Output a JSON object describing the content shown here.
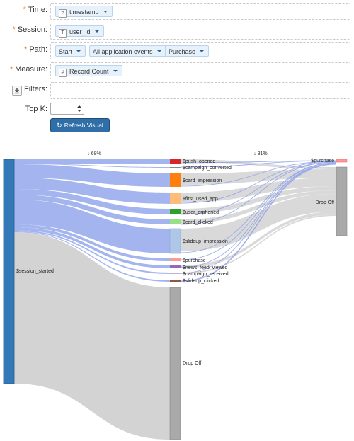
{
  "form": {
    "time": {
      "label": "Time:",
      "pill_type": "#",
      "pill_text": "timestamp"
    },
    "session": {
      "label": "Session:",
      "pill_type": "T",
      "pill_text": "user_id"
    },
    "path": {
      "label": "Path:",
      "pills": [
        "Start",
        "All application events",
        "Purchase"
      ]
    },
    "measure": {
      "label": "Measure:",
      "pill_type": "#",
      "pill_text": "Record Count"
    },
    "filters": {
      "label": "Filters:"
    },
    "topk": {
      "label": "Top K:",
      "value": ""
    },
    "refresh_label": "Refresh Visual",
    "required_mark": "*"
  },
  "sankey": {
    "step_labels": [
      "↓ 68%",
      "↓ 31%"
    ],
    "source": "$session_started",
    "mid_nodes": [
      {
        "name": "$push_opened",
        "color": "#d62728"
      },
      {
        "name": "$campaign_converted",
        "color": "#e8e8e8"
      },
      {
        "name": "$card_impression",
        "color": "#ff7f0e"
      },
      {
        "name": "$first_used_app",
        "color": "#ffbb78"
      },
      {
        "name": "$user_orphaned",
        "color": "#2ca02c"
      },
      {
        "name": "$card_clicked",
        "color": "#98df8a"
      },
      {
        "name": "$slideup_impression",
        "color": "#aec7e8"
      },
      {
        "name": "$purchase",
        "color": "#ff9896"
      },
      {
        "name": "$news_feed_viewed",
        "color": "#9467bd"
      },
      {
        "name": "$campaign_received",
        "color": "#c5b0d5"
      },
      {
        "name": "$slideup_clicked",
        "color": "#8c564b"
      },
      {
        "name": "Drop Off",
        "color": "#a9a9a9"
      }
    ],
    "end_nodes": [
      {
        "name": "$purchase",
        "color": "#ff9896"
      },
      {
        "name": "Drop Off",
        "color": "#a9a9a9"
      }
    ]
  }
}
